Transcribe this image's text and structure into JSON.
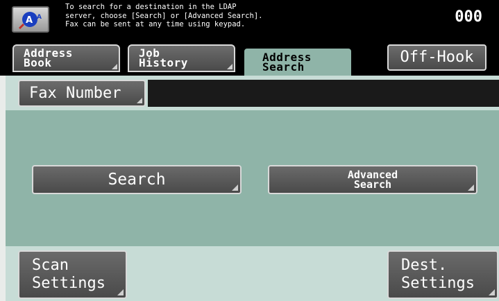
{
  "message": {
    "lines": [
      "To search for a destination in the LDAP",
      "server, choose [Search] or [Advanced Search].",
      "Fax can be sent at any time using keypad."
    ],
    "counter": "000"
  },
  "tabs": [
    {
      "line1": "Address",
      "line2": "Book"
    },
    {
      "line1": "Job",
      "line2": "History"
    },
    {
      "line1": "Address",
      "line2": "Search"
    }
  ],
  "offhook_label": "Off-Hook",
  "fax": {
    "label": "Fax Number",
    "value": ""
  },
  "buttons": {
    "search": "Search",
    "advanced_line1": "Advanced",
    "advanced_line2": "Search"
  },
  "bottom": {
    "scan_line1": "Scan",
    "scan_line2": "Settings",
    "dest_line1": "Dest.",
    "dest_line2": "Settings"
  },
  "icons": {
    "help": "help-icon"
  }
}
